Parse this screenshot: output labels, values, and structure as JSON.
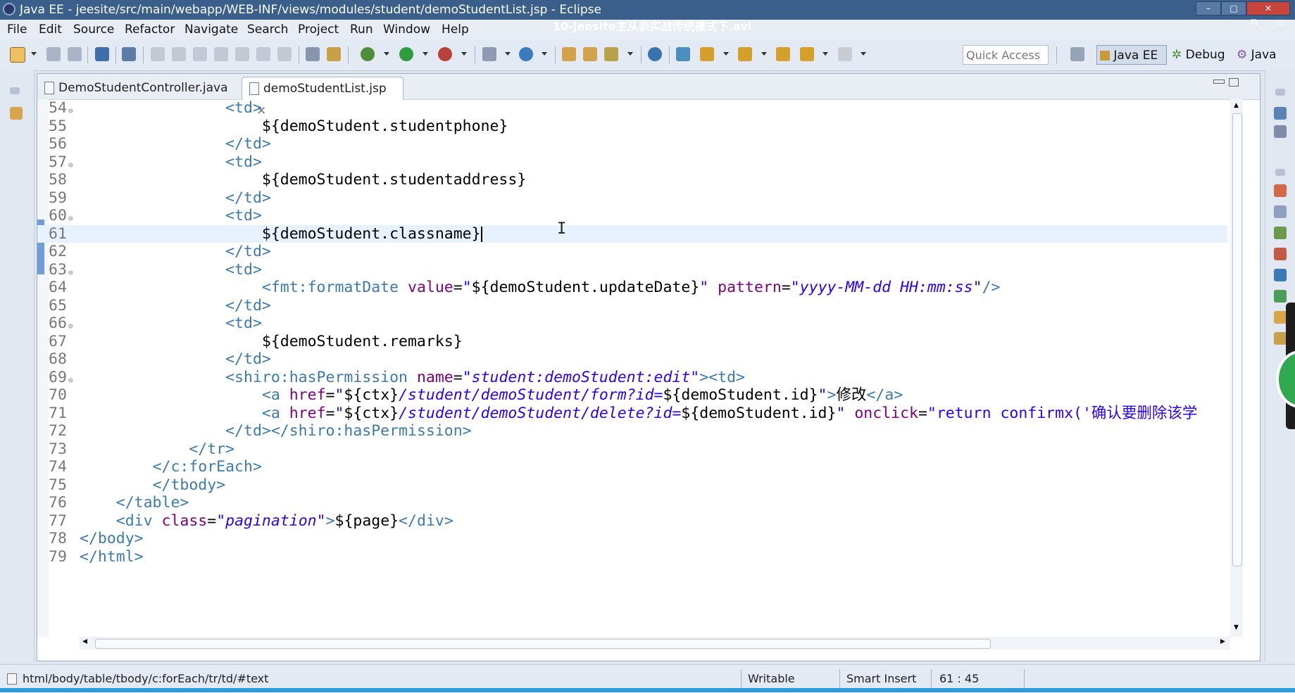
{
  "window": {
    "title": "Java EE - jeesite/src/main/webapp/WEB-INF/views/modules/student/demoStudentList.jsp - Eclipse",
    "video_overlay": "10-jeesite主从表实战传统模式下.avi"
  },
  "menu": [
    "File",
    "Edit",
    "Source",
    "Refactor",
    "Navigate",
    "Search",
    "Project",
    "Run",
    "Window",
    "Help"
  ],
  "toolbar": {
    "quick_access_placeholder": "Quick Access",
    "perspectives": [
      "Java EE",
      "Debug",
      "Java"
    ]
  },
  "tabs": [
    {
      "label": "DemoStudentController.java",
      "active": false
    },
    {
      "label": "demoStudentList.jsp",
      "active": true
    }
  ],
  "code": {
    "current_line": 61,
    "lines": [
      {
        "n": "54",
        "fold": true,
        "text": "                <td>"
      },
      {
        "n": "55",
        "fold": false,
        "text": "                    ${demoStudent.studentphone}"
      },
      {
        "n": "56",
        "fold": false,
        "text": "                </td>"
      },
      {
        "n": "57",
        "fold": true,
        "text": "                <td>"
      },
      {
        "n": "58",
        "fold": false,
        "text": "                    ${demoStudent.studentaddress}"
      },
      {
        "n": "59",
        "fold": false,
        "text": "                </td>"
      },
      {
        "n": "60",
        "fold": true,
        "text": "                <td>"
      },
      {
        "n": "61",
        "fold": false,
        "text": "                    ${demoStudent.classname}"
      },
      {
        "n": "62",
        "fold": false,
        "text": "                </td>"
      },
      {
        "n": "63",
        "fold": true,
        "text": "                <td>"
      },
      {
        "n": "64",
        "fold": false,
        "text": "                    <fmt:formatDate value=\"${demoStudent.updateDate}\" pattern=\"yyyy-MM-dd HH:mm:ss\"/>"
      },
      {
        "n": "65",
        "fold": false,
        "text": "                </td>"
      },
      {
        "n": "66",
        "fold": true,
        "text": "                <td>"
      },
      {
        "n": "67",
        "fold": false,
        "text": "                    ${demoStudent.remarks}"
      },
      {
        "n": "68",
        "fold": false,
        "text": "                </td>"
      },
      {
        "n": "69",
        "fold": true,
        "text": "                <shiro:hasPermission name=\"student:demoStudent:edit\"><td>"
      },
      {
        "n": "70",
        "fold": false,
        "text": "                    <a href=\"${ctx}/student/demoStudent/form?id=${demoStudent.id}\">修改</a>"
      },
      {
        "n": "71",
        "fold": false,
        "text": "                    <a href=\"${ctx}/student/demoStudent/delete?id=${demoStudent.id}\" onclick=\"return confirmx('确认要删除该学"
      },
      {
        "n": "72",
        "fold": false,
        "text": "                </td></shiro:hasPermission>"
      },
      {
        "n": "73",
        "fold": false,
        "text": "            </tr>"
      },
      {
        "n": "74",
        "fold": false,
        "text": "        </c:forEach>"
      },
      {
        "n": "75",
        "fold": false,
        "text": "        </tbody>"
      },
      {
        "n": "76",
        "fold": false,
        "text": "    </table>"
      },
      {
        "n": "77",
        "fold": false,
        "text": "    <div class=\"pagination\">${page}</div>"
      },
      {
        "n": "78",
        "fold": false,
        "text": "</body>"
      },
      {
        "n": "79",
        "fold": false,
        "text": "</html>"
      }
    ]
  },
  "status": {
    "path": "html/body/table/tbody/c:forEach/tr/td/#text",
    "writable": "Writable",
    "insert_mode": "Smart Insert",
    "position": "61 : 45"
  },
  "colors": {
    "tag": "#3c7ab0",
    "attribute": "#7f007f",
    "string": "#2a00ff",
    "current_line": "#e8f2fe"
  }
}
